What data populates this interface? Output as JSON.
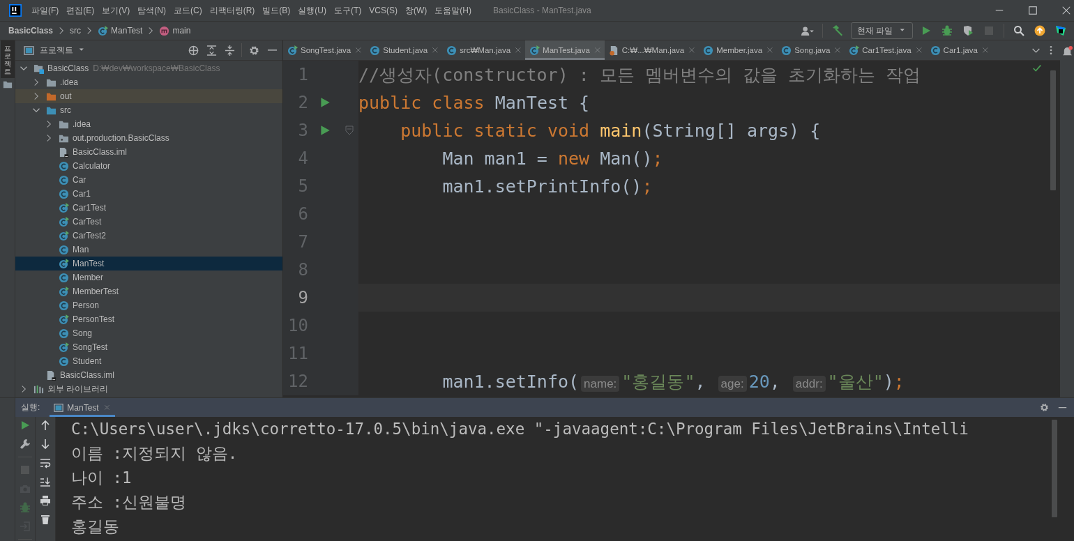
{
  "title_bar": {
    "menus": [
      "파일(F)",
      "편집(E)",
      "보기(V)",
      "탐색(N)",
      "코드(C)",
      "리팩터링(R)",
      "빌드(B)",
      "실행(U)",
      "도구(T)",
      "VCS(S)",
      "창(W)",
      "도움말(H)"
    ],
    "title": "BasicClass - ManTest.java"
  },
  "breadcrumbs": [
    {
      "label": "BasicClass",
      "kind": "project"
    },
    {
      "label": "src",
      "kind": "folder"
    },
    {
      "label": "ManTest",
      "kind": "runnable-class"
    },
    {
      "label": "main",
      "kind": "method"
    }
  ],
  "toolbar": {
    "run_config": "현재 파일",
    "buttons": [
      {
        "kind": "user",
        "disabled": false
      },
      {
        "kind": "build",
        "disabled": false
      },
      {
        "kind": "config"
      },
      {
        "kind": "run",
        "disabled": false
      },
      {
        "kind": "debug",
        "disabled": false
      },
      {
        "kind": "coverage",
        "disabled": false
      },
      {
        "kind": "stop",
        "disabled": true
      },
      {
        "kind": "search",
        "disabled": false
      },
      {
        "kind": "update",
        "disabled": false
      },
      {
        "kind": "toolbox",
        "disabled": false
      }
    ]
  },
  "left_stripe": {
    "tab": "프로젝트"
  },
  "project_panel": {
    "title": "프로젝트",
    "tree": [
      {
        "label": "BasicClass",
        "path": "D:₩dev₩workspace₩BasicClass",
        "kind": "project",
        "expanded": true,
        "selected": false,
        "children": [
          {
            "label": ".idea",
            "kind": "folder",
            "expanded": false,
            "selected": false
          },
          {
            "label": "out",
            "kind": "excluded-folder",
            "expanded": false,
            "selected": false
          },
          {
            "label": "src",
            "kind": "source-folder",
            "expanded": true,
            "selected": false,
            "children": [
              {
                "label": ".idea",
                "kind": "folder",
                "expanded": false,
                "selected": false
              },
              {
                "label": "out.production.BasicClass",
                "kind": "package",
                "expanded": false,
                "selected": false
              },
              {
                "label": "BasicClass.iml",
                "kind": "module-file",
                "selected": false
              },
              {
                "label": "Calculator",
                "kind": "class",
                "selected": false
              },
              {
                "label": "Car",
                "kind": "class",
                "selected": false
              },
              {
                "label": "Car1",
                "kind": "class",
                "selected": false
              },
              {
                "label": "Car1Test",
                "kind": "runnable-class",
                "selected": false
              },
              {
                "label": "CarTest",
                "kind": "runnable-class",
                "selected": false
              },
              {
                "label": "CarTest2",
                "kind": "runnable-class",
                "selected": false
              },
              {
                "label": "Man",
                "kind": "class",
                "selected": false
              },
              {
                "label": "ManTest",
                "kind": "runnable-class",
                "selected": true
              },
              {
                "label": "Member",
                "kind": "class",
                "selected": false
              },
              {
                "label": "MemberTest",
                "kind": "runnable-class",
                "selected": false
              },
              {
                "label": "Person",
                "kind": "class",
                "selected": false
              },
              {
                "label": "PersonTest",
                "kind": "runnable-class",
                "selected": false
              },
              {
                "label": "Song",
                "kind": "class",
                "selected": false
              },
              {
                "label": "SongTest",
                "kind": "runnable-class",
                "selected": false
              },
              {
                "label": "Student",
                "kind": "class",
                "selected": false
              }
            ]
          },
          {
            "label": "BasicClass.iml",
            "kind": "module-file",
            "selected": false
          }
        ]
      },
      {
        "label": "외부 라이브러리",
        "kind": "library",
        "expanded": false,
        "selected": false
      }
    ]
  },
  "editor": {
    "tabs": [
      {
        "label": "SongTest.java",
        "kind": "runnable-class",
        "selected": false
      },
      {
        "label": "Student.java",
        "kind": "class",
        "selected": false
      },
      {
        "label": "src₩Man.java",
        "kind": "class",
        "selected": false
      },
      {
        "label": "ManTest.java",
        "kind": "runnable-class",
        "selected": true
      },
      {
        "label": "C:₩...₩Man.java",
        "kind": "java-file",
        "selected": false
      },
      {
        "label": "Member.java",
        "kind": "class",
        "selected": false
      },
      {
        "label": "Song.java",
        "kind": "class",
        "selected": false
      },
      {
        "label": "Car1Test.java",
        "kind": "runnable-class",
        "selected": false
      },
      {
        "label": "Car1.java",
        "kind": "class",
        "selected": false
      }
    ],
    "lines": [
      {
        "number": "1",
        "run_marker": false,
        "fold": false,
        "current": false,
        "tokens": [
          {
            "kind": "comment",
            "text": "//생성자(constructor) : 모든 멤버변수의 값을 초기화하는 작업"
          }
        ]
      },
      {
        "number": "2",
        "run_marker": true,
        "fold": false,
        "current": false,
        "tokens": [
          {
            "kind": "keyword",
            "text": "public class "
          },
          {
            "kind": "plain",
            "text": "ManTest {"
          }
        ]
      },
      {
        "number": "3",
        "run_marker": true,
        "fold": true,
        "current": false,
        "tokens": [
          {
            "kind": "keyword",
            "text": "    public static void "
          },
          {
            "kind": "method",
            "text": "main"
          },
          {
            "kind": "plain",
            "text": "(String[] args) {"
          }
        ]
      },
      {
        "number": "4",
        "run_marker": false,
        "fold": false,
        "current": false,
        "tokens": [
          {
            "kind": "plain",
            "text": "        Man man1 = "
          },
          {
            "kind": "keyword",
            "text": "new "
          },
          {
            "kind": "plain",
            "text": "Man()"
          },
          {
            "kind": "punct",
            "text": ";"
          }
        ]
      },
      {
        "number": "5",
        "run_marker": false,
        "fold": false,
        "current": false,
        "tokens": [
          {
            "kind": "plain",
            "text": "        man1.setPrintInfo()"
          },
          {
            "kind": "punct",
            "text": ";"
          }
        ]
      },
      {
        "number": "6",
        "run_marker": false,
        "fold": false,
        "current": false
      },
      {
        "number": "7",
        "run_marker": false,
        "fold": false,
        "current": false
      },
      {
        "number": "8",
        "run_marker": false,
        "fold": false,
        "current": false
      },
      {
        "number": "9",
        "run_marker": false,
        "fold": false,
        "current": true
      },
      {
        "number": "10",
        "run_marker": false,
        "fold": false,
        "current": false
      },
      {
        "number": "11",
        "run_marker": false,
        "fold": false,
        "current": false
      },
      {
        "number": "12",
        "run_marker": false,
        "fold": false,
        "current": false,
        "tokens": [
          {
            "kind": "plain",
            "text": "        man1.setInfo("
          },
          {
            "kind": "hint",
            "text": "name:"
          },
          {
            "kind": "string",
            "text": "\"홍길동\""
          },
          {
            "kind": "plain",
            "text": ", "
          },
          {
            "kind": "hint",
            "text": "age:"
          },
          {
            "kind": "number",
            "text": "20"
          },
          {
            "kind": "plain",
            "text": ", "
          },
          {
            "kind": "hint",
            "text": "addr:"
          },
          {
            "kind": "string",
            "text": "\"울산\""
          },
          {
            "kind": "plain",
            "text": ")"
          },
          {
            "kind": "punct",
            "text": ";"
          }
        ]
      }
    ]
  },
  "run_panel": {
    "label": "실행:",
    "tab": "ManTest",
    "tools_left": [
      {
        "kind": "run",
        "disabled": false
      },
      {
        "kind": "wrench",
        "disabled": false
      },
      {
        "kind": "separator"
      },
      {
        "kind": "stop",
        "disabled": true
      },
      {
        "kind": "camera",
        "disabled": true
      },
      {
        "kind": "debug",
        "disabled": true
      },
      {
        "kind": "enter",
        "disabled": true
      },
      {
        "kind": "separator"
      }
    ],
    "tools_right": [
      {
        "kind": "up",
        "disabled": false
      },
      {
        "kind": "down",
        "disabled": false
      },
      {
        "kind": "wrap",
        "disabled": false
      },
      {
        "kind": "scroll-end",
        "disabled": false
      },
      {
        "kind": "print",
        "disabled": false
      },
      {
        "kind": "trash",
        "disabled": false
      }
    ],
    "output": [
      "C:\\Users\\user\\.jdks\\corretto-17.0.5\\bin\\java.exe \"-javaagent:C:\\Program Files\\JetBrains\\Intelli",
      "이름 :지정되지 않음.",
      "나이 :1",
      "주소 :신원불명",
      "홍길동"
    ]
  }
}
